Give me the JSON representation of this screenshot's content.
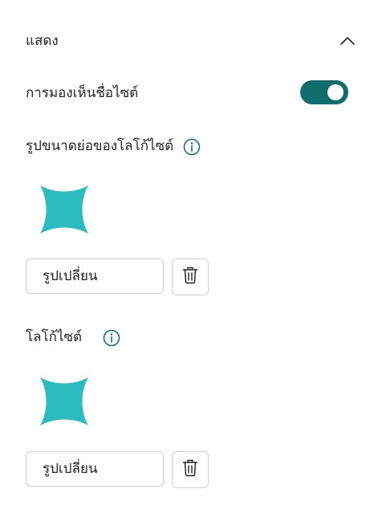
{
  "section": {
    "title": "แสดง",
    "collapse_icon": "chevron-up-icon"
  },
  "visibility": {
    "label": "การมองเห็นชื่อไซต์",
    "toggle_on": true,
    "accent": "#0f6d6e"
  },
  "thumbnail": {
    "label": "รูปขนาดย่อของโลโก้ไซต์",
    "info_icon": "info-icon",
    "logo_icon": "sparkle-star-logo",
    "logo_color": "#2bbcc0",
    "change_label": "รูปเปลี่ยน",
    "delete_icon": "trash-icon"
  },
  "site_logo": {
    "label": "โลโก้ไซต์",
    "info_icon": "info-icon",
    "logo_icon": "sparkle-star-logo",
    "logo_color": "#2bbcc0",
    "change_label": "รูปเปลี่ยน",
    "delete_icon": "trash-icon"
  }
}
